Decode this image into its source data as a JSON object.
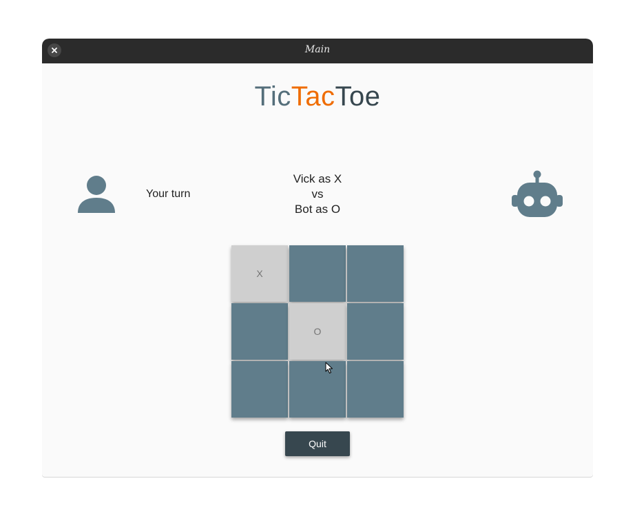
{
  "window": {
    "title": "Main"
  },
  "header": {
    "title_parts": {
      "tic": "Tic",
      "tac": "Tac",
      "toe": "Toe"
    },
    "colors": {
      "tic": "#546e7a",
      "tac": "#ef6c00",
      "toe": "#37474f"
    }
  },
  "status": {
    "turn_text": "Your turn",
    "player_line": "Vick as X",
    "vs_line": "vs",
    "bot_line": "Bot as O"
  },
  "icons": {
    "player": "person-icon",
    "bot": "robot-icon",
    "close": "close-icon"
  },
  "board": {
    "cells": [
      "X",
      "",
      "",
      "",
      "O",
      "",
      "",
      "",
      ""
    ],
    "colors": {
      "empty": "#607d8b",
      "played": "#cfcfcf"
    }
  },
  "actions": {
    "quit_label": "Quit"
  }
}
